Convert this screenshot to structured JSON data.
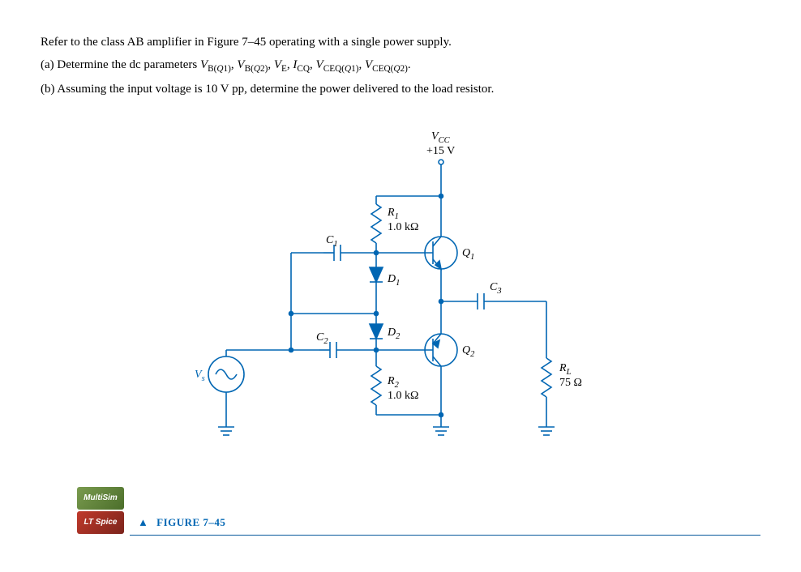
{
  "problem": {
    "intro": "Refer to the class AB amplifier in Figure 7–45 operating with a single power supply.",
    "part_a_prefix": "(a)  Determine the dc parameters ",
    "part_a_vars": "V_B(Q1), V_B(Q2), V_E, I_CQ, V_CEQ(Q1), V_CEQ(Q2).",
    "part_b": "(b)  Assuming the input voltage is 10 V pp, determine the power delivered to the load resistor."
  },
  "circuit": {
    "Vcc_label": "V_CC",
    "Vcc_value": "+15 V",
    "R1_label": "R_1",
    "R1_value": "1.0 kΩ",
    "R2_label": "R_2",
    "R2_value": "1.0 kΩ",
    "C1": "C_1",
    "C2": "C_2",
    "C3": "C_3",
    "D1": "D_1",
    "D2": "D_2",
    "Q1": "Q_1",
    "Q2": "Q_2",
    "RL_label": "R_L",
    "RL_value": "75 Ω",
    "Vs": "V_s"
  },
  "figure": {
    "arrow": "▲",
    "caption": "FIGURE 7–45"
  },
  "badges": {
    "multisim": "MultiSim",
    "ltspice": "LT Spice"
  }
}
